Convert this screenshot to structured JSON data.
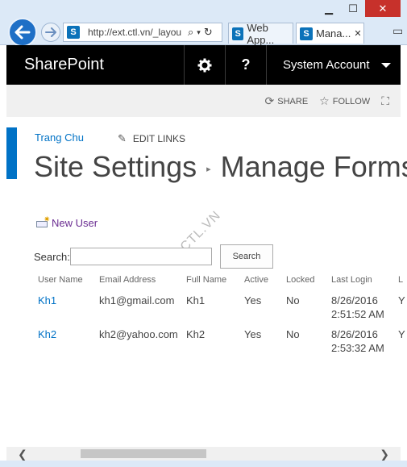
{
  "browser": {
    "address": "http://ext.ctl.vn/_layou",
    "tabs": [
      {
        "label": "Web App..."
      },
      {
        "label": "Mana..."
      }
    ]
  },
  "suitebar": {
    "brand": "SharePoint",
    "account": "System Account"
  },
  "ribbon": {
    "share": "SHARE",
    "follow": "FOLLOW"
  },
  "page": {
    "breadcrumb": "Trang Chu",
    "edit_links": "EDIT LINKS",
    "title_parent": "Site Settings",
    "title_current": "Manage Forms",
    "new_user": "New User",
    "search_label": "Search:",
    "search_value": "",
    "search_button": "Search",
    "watermark": "CTL.VN"
  },
  "table": {
    "headers": [
      "User Name",
      "Email Address",
      "Full Name",
      "Active",
      "Locked",
      "Last Login",
      "L"
    ],
    "rows": [
      {
        "user": "Kh1",
        "email": "kh1@gmail.com",
        "full": "Kh1",
        "active": "Yes",
        "locked": "No",
        "date": "8/26/2016",
        "time": "2:51:52 AM",
        "extra": "Y"
      },
      {
        "user": "Kh2",
        "email": "kh2@yahoo.com",
        "full": "Kh2",
        "active": "Yes",
        "locked": "No",
        "date": "8/26/2016",
        "time": "2:53:32 AM",
        "extra": "Y"
      }
    ]
  },
  "colors": {
    "accent": "#0072c6",
    "suitebar": "#000000",
    "new_user_link": "#6a2c91"
  }
}
